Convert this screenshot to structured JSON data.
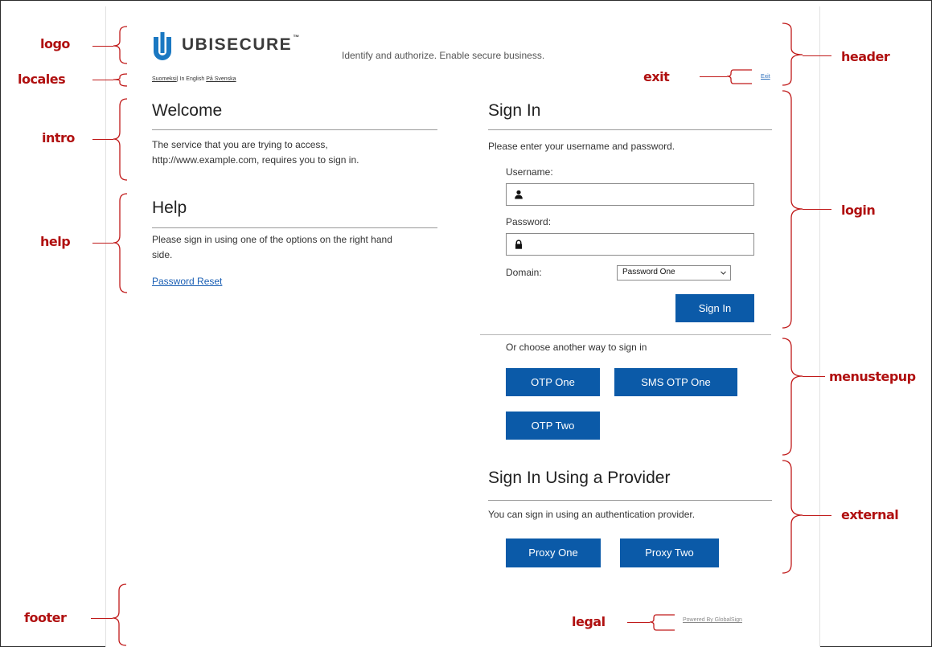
{
  "logo": {
    "text": "UBISECURE",
    "tm": "™",
    "mark_color": "#1a78c2"
  },
  "header": {
    "tagline": "Identify and authorize. Enable secure business."
  },
  "locales": {
    "finnish": "Suomeksi",
    "english": "In English",
    "swedish": "På Svenska"
  },
  "exit": {
    "label": "Exit"
  },
  "intro": {
    "title": "Welcome",
    "line1": "The service that you are trying to access,",
    "line2": "http://www.example.com, requires you to sign in."
  },
  "help": {
    "title": "Help",
    "line1": "Please sign in using one of the options on the right hand",
    "line2": "side.",
    "password_reset": "Password Reset"
  },
  "login": {
    "title": "Sign In",
    "instructions": "Please enter your username and password.",
    "username_label": "Username:",
    "username_value": "",
    "password_label": "Password:",
    "password_value": "",
    "domain_label": "Domain:",
    "domain_value": "Password One",
    "submit": "Sign In"
  },
  "menustepup": {
    "prompt": "Or choose another way to sign in",
    "buttons": [
      "OTP One",
      "SMS OTP One",
      "OTP Two"
    ]
  },
  "external": {
    "title": "Sign In Using a Provider",
    "description": "You can sign in using an authentication provider.",
    "buttons": [
      "Proxy One",
      "Proxy Two"
    ]
  },
  "legal": {
    "powered_by": "Powered By GlobalSign"
  },
  "annotations": {
    "logo": "logo",
    "locales": "locales",
    "intro": "intro",
    "help": "help",
    "footer": "footer",
    "header": "header",
    "exit": "exit",
    "login": "login",
    "menustepup": "menustepup",
    "external": "external",
    "legal": "legal"
  },
  "colors": {
    "button": "#0b5aa8",
    "annotation": "#c01a1a",
    "link": "#1a5fb4"
  }
}
